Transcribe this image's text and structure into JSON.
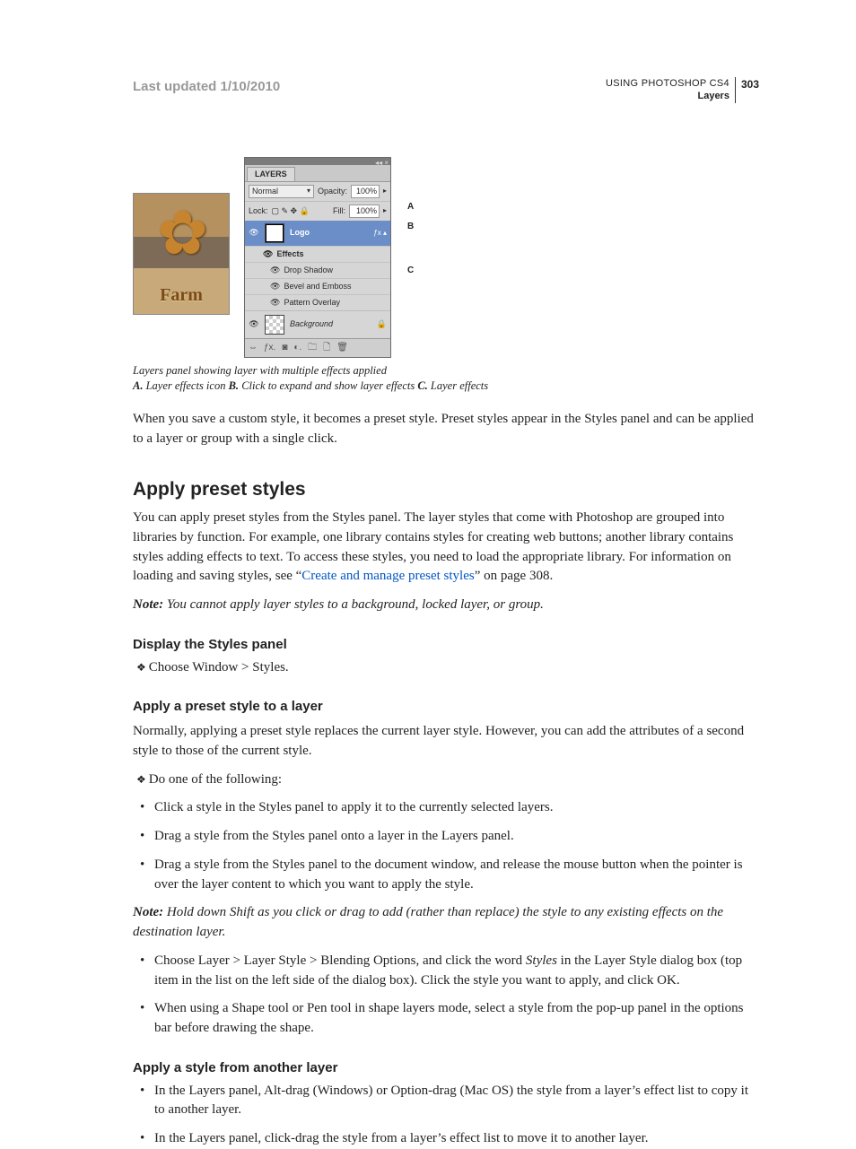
{
  "header": {
    "last_updated": "Last updated 1/10/2010",
    "doc_title": "USING PHOTOSHOP CS4",
    "section": "Layers",
    "page_number": "303"
  },
  "figure": {
    "thumb_word": "Farm",
    "panel": {
      "tab": "LAYERS",
      "blend_mode": "Normal",
      "opacity_label": "Opacity:",
      "opacity_value": "100%",
      "lock_label": "Lock:",
      "fill_label": "Fill:",
      "fill_value": "100%",
      "layer_name": "Logo",
      "effects_label": "Effects",
      "effects": [
        "Drop Shadow",
        "Bevel and Emboss",
        "Pattern Overlay"
      ],
      "background_label": "Background"
    },
    "callouts": {
      "a": "A",
      "b": "B",
      "c": "C"
    },
    "caption_line1": "Layers panel showing layer with multiple effects applied",
    "caption_a_label": "A.",
    "caption_a_text": " Layer effects icon  ",
    "caption_b_label": "B.",
    "caption_b_text": " Click to expand and show layer effects  ",
    "caption_c_label": "C.",
    "caption_c_text": " Layer effects"
  },
  "body": {
    "p_save_style": "When you save a custom style, it becomes a preset style. Preset styles appear in the Styles panel and can be applied to a layer or group with a single click.",
    "h2_apply": "Apply preset styles",
    "p_apply_intro_a": "You can apply preset styles from the Styles panel. The layer styles that come with Photoshop are grouped into libraries by function. For example, one library contains styles for creating web buttons; another library contains styles adding effects to text. To access these styles, you need to load the appropriate library. For information on loading and saving styles, see “",
    "link_create_manage": "Create and manage preset styles",
    "p_apply_intro_b": "” on page 308.",
    "note1_label": "Note:",
    "note1_text": " You cannot apply layer styles to a background, locked layer, or group.",
    "h3_display": "Display the Styles panel",
    "li_choose_window": "Choose Window > Styles.",
    "h3_apply_layer": "Apply a preset style to a layer",
    "p_normally": "Normally, applying a preset style replaces the current layer style. However, you can add the attributes of a second style to those of the current style.",
    "li_do_one": "Do one of the following:",
    "li_click_style": "Click a style in the Styles panel to apply it to the currently selected layers.",
    "li_drag_onto_layer": "Drag a style from the Styles panel onto a layer in the Layers panel.",
    "li_drag_doc_window": "Drag a style from the Styles panel to the document window, and release the mouse button when the pointer is over the layer content to which you want to apply the style.",
    "note2_label": "Note:",
    "note2_text": " Hold down Shift as you click or drag to add (rather than replace) the style to any existing effects on the destination layer.",
    "li_choose_layer_a": "Choose Layer > Layer Style > Blending Options, and click the word ",
    "li_choose_layer_styles_word": "Styles",
    "li_choose_layer_b": " in the Layer Style dialog box (top item in the list on the left side of the dialog box). Click the style you want to apply, and click OK.",
    "li_shape_tool": "When using a Shape tool or Pen tool in shape layers mode, select a style from the pop-up panel in the options bar before drawing the shape.",
    "h3_apply_from_another": "Apply a style from another layer",
    "li_alt_drag": "In the Layers panel, Alt-drag (Windows) or Option-drag (Mac OS) the style from a layer’s effect list to copy it to another layer.",
    "li_click_drag": "In the Layers panel, click-drag the style from a layer’s effect list to move it to another layer."
  }
}
